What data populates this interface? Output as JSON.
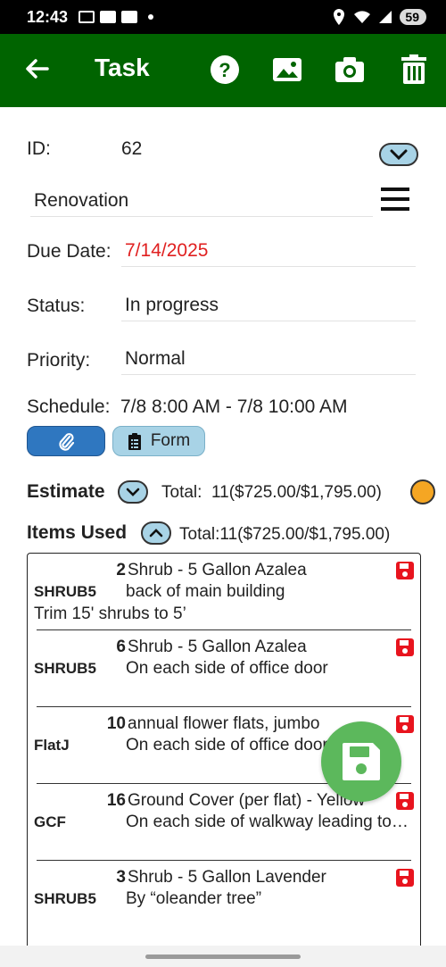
{
  "status_bar": {
    "time": "12:43",
    "battery": "59"
  },
  "app_bar": {
    "title": "Task"
  },
  "form": {
    "id_label": "ID:",
    "id_value": "62",
    "name_value": "Renovation",
    "due_label": "Due Date:",
    "due_value": "7/14/2025",
    "status_label": "Status:",
    "status_value": "In progress",
    "priority_label": "Priority:",
    "priority_value": "Normal",
    "schedule_label": "Schedule:",
    "schedule_value": "7/8 8:00 AM - 7/8 10:00 AM",
    "form_button_label": "Form"
  },
  "estimate": {
    "title": "Estimate",
    "total": "Total:  11($725.00/$1,795.00)"
  },
  "items_used": {
    "title": "Items Used",
    "total": "Total:11($725.00/$1,795.00)",
    "items": [
      {
        "qty": "2",
        "desc": "Shrub - 5 Gallon Azalea",
        "code": "SHRUB5",
        "loc": "back of main building",
        "note": "Trim 15' shrubs to 5’"
      },
      {
        "qty": "6",
        "desc": "Shrub - 5 Gallon Azalea",
        "code": "SHRUB5",
        "loc": "On each side of office door",
        "note": ""
      },
      {
        "qty": "10",
        "desc": "annual flower flats, jumbo",
        "code": "FlatJ",
        "loc": "On each side of office door",
        "note": ""
      },
      {
        "qty": "16",
        "desc": "Ground Cover (per flat) - Yellow",
        "code": "GCF",
        "loc": "On each side of walkway leading to entrance",
        "note": ""
      },
      {
        "qty": "3",
        "desc": "Shrub - 5 Gallon Lavender",
        "code": "SHRUB5",
        "loc": "By “oleander tree”",
        "note": ""
      }
    ]
  },
  "colors": {
    "appbar": "#006400",
    "accent_blue": "#a8d3e6",
    "due_date_red": "#e02020",
    "fab_green": "#5cb85c"
  }
}
